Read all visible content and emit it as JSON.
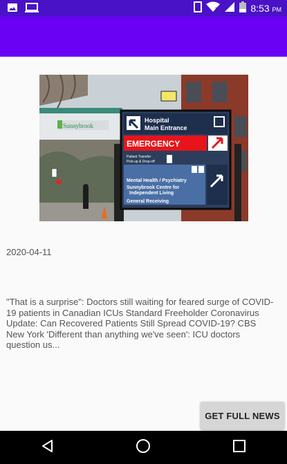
{
  "status_bar": {
    "time": "8:53",
    "ampm": "PM",
    "icons": [
      "image-icon",
      "cast-icon",
      "sim-icon",
      "wifi-icon",
      "signal-icon",
      "battery-icon"
    ]
  },
  "article": {
    "date": "2020-04-11",
    "summary": "\"That is a surprise\": Doctors still waiting for feared surge of COVID-19 patients in Canadian ICUs Standard Freeholder Coronavirus Update: Can Recovered Patients Still Spread COVID-19? CBS New York 'Different than anything we've seen': ICU doctors question us...",
    "button_label": "GET FULL NEWS",
    "image": {
      "building_sign": "Sunnybrook",
      "sign_lines": {
        "hospital": "Hospital",
        "main_entrance": "Main Entrance",
        "emergency": "EMERGENCY",
        "patient_transfer": "Patient Transfer",
        "pickup": "Pick-up & Drop-off",
        "mental_health": "Mental Health / Psychiatry",
        "sunnybrook_centre": "Sunnybrook Centre for",
        "independent_living": "Independent Living",
        "general_receiving": "General Receiving"
      }
    }
  },
  "nav": {
    "icons": [
      "back-icon",
      "home-icon",
      "recents-icon"
    ]
  },
  "colors": {
    "status_bar": "#4a12c6",
    "app_bar": "#6a00f4",
    "emergency": "#e8141b"
  }
}
